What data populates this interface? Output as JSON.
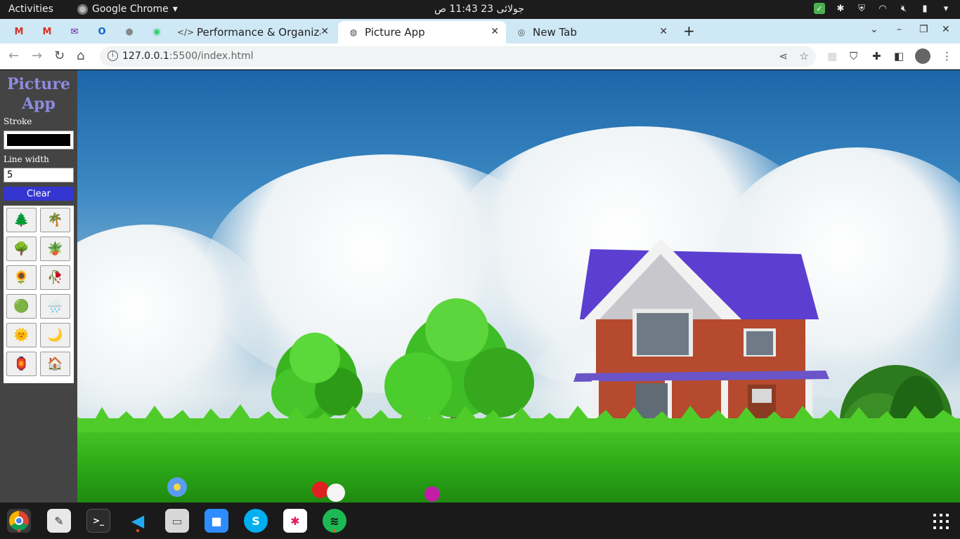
{
  "topbar": {
    "activities": "Activities",
    "app_name": "Google Chrome",
    "clock": "جولائی 23  11:43 ص"
  },
  "tabs": [
    {
      "label": "Performance & Organizat",
      "favicon": "code-icon",
      "active": false
    },
    {
      "label": "Picture App",
      "favicon": "globe-icon",
      "active": true
    },
    {
      "label": "New Tab",
      "favicon": "chrome-icon",
      "active": false
    }
  ],
  "address": {
    "host": "127.0.0.1",
    "rest": ":5500/index.html"
  },
  "app": {
    "title": "Picture App",
    "stroke_label": "Stroke",
    "stroke_color": "#000000",
    "line_width_label": "Line width",
    "line_width_value": "5",
    "clear_label": "Clear",
    "stamps": [
      "🌲",
      "🌴",
      "🌳",
      "🪴",
      "🌻",
      "🥀",
      "🟢",
      "🌧️",
      "🌞",
      "🌙",
      "🏮",
      "🏠"
    ]
  },
  "colors": {
    "accent_button": "#3535d0",
    "title_color": "#8e8be0",
    "sidebar_bg": "#444444"
  }
}
